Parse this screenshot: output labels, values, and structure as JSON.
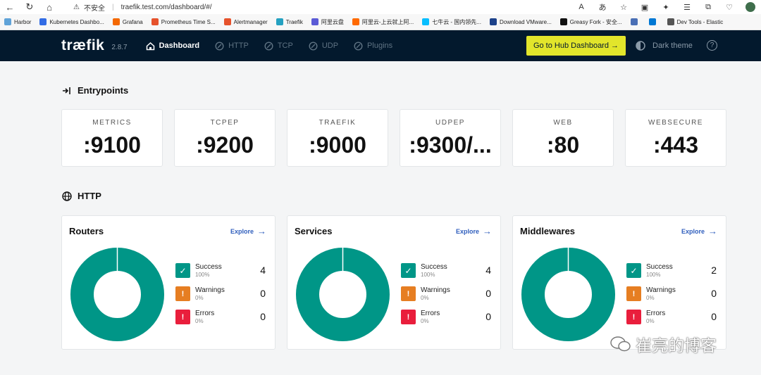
{
  "browser": {
    "security_label": "不安全",
    "url": "traefik.test.com/dashboard/#/",
    "bookmarks": [
      {
        "label": "Harbor",
        "color": "#60a3d8"
      },
      {
        "label": "Kubernetes Dashbo...",
        "color": "#326ce5"
      },
      {
        "label": "Grafana",
        "color": "#f46800"
      },
      {
        "label": "Prometheus Time S...",
        "color": "#e6522c"
      },
      {
        "label": "Alertmanager",
        "color": "#e6522c"
      },
      {
        "label": "Traefik",
        "color": "#24a1c1"
      },
      {
        "label": "阿里云盘",
        "color": "#5b5bd6"
      },
      {
        "label": "阿里云-上云就上阿...",
        "color": "#ff6a00"
      },
      {
        "label": "七牛云 - 国内领先...",
        "color": "#07beff"
      },
      {
        "label": "Download VMware...",
        "color": "#1d428a"
      },
      {
        "label": "Greasy Fork - 安全...",
        "color": "#111111"
      },
      {
        "label": "",
        "color": "#4a6fb5"
      },
      {
        "label": "",
        "color": "#0078d4"
      },
      {
        "label": "Dev Tools - Elastic",
        "color": "#555555"
      }
    ]
  },
  "app": {
    "logo": "træfik",
    "version": "2.8.7",
    "nav": [
      {
        "label": "Dashboard",
        "icon": "home-icon",
        "active": true
      },
      {
        "label": "HTTP",
        "icon": "globe-icon",
        "active": false
      },
      {
        "label": "TCP",
        "icon": "tcp-icon",
        "active": false
      },
      {
        "label": "UDP",
        "icon": "udp-icon",
        "active": false
      },
      {
        "label": "Plugins",
        "icon": "puzzle-icon",
        "active": false
      }
    ],
    "hub_button": "Go to Hub Dashboard →",
    "dark_theme": "Dark theme",
    "help": "?"
  },
  "entrypoints": {
    "title": "Entrypoints",
    "items": [
      {
        "name": "METRICS",
        "value": ":9100"
      },
      {
        "name": "TCPEP",
        "value": ":9200"
      },
      {
        "name": "TRAEFIK",
        "value": ":9000"
      },
      {
        "name": "UDPEP",
        "value": ":9300/..."
      },
      {
        "name": "WEB",
        "value": ":80"
      },
      {
        "name": "WEBSECURE",
        "value": ":443"
      }
    ]
  },
  "http": {
    "title": "HTTP",
    "panels": [
      {
        "title": "Routers",
        "explore": "Explore",
        "stats": [
          {
            "label": "Success",
            "pct": "100%",
            "count": "4"
          },
          {
            "label": "Warnings",
            "pct": "0%",
            "count": "0"
          },
          {
            "label": "Errors",
            "pct": "0%",
            "count": "0"
          }
        ],
        "success_fraction": 1.0
      },
      {
        "title": "Services",
        "explore": "Explore",
        "stats": [
          {
            "label": "Success",
            "pct": "100%",
            "count": "4"
          },
          {
            "label": "Warnings",
            "pct": "0%",
            "count": "0"
          },
          {
            "label": "Errors",
            "pct": "0%",
            "count": "0"
          }
        ],
        "success_fraction": 1.0
      },
      {
        "title": "Middlewares",
        "explore": "Explore",
        "stats": [
          {
            "label": "Success",
            "pct": "100%",
            "count": "2"
          },
          {
            "label": "Warnings",
            "pct": "0%",
            "count": "0"
          },
          {
            "label": "Errors",
            "pct": "0%",
            "count": "0"
          }
        ],
        "success_fraction": 1.0
      }
    ]
  },
  "colors": {
    "success": "#009687",
    "warning": "#e67e22",
    "error": "#e91e3c",
    "header": "#03192d",
    "hub": "#e2e52b",
    "link": "#2f5ebd"
  },
  "watermark": "崔亮的博客"
}
